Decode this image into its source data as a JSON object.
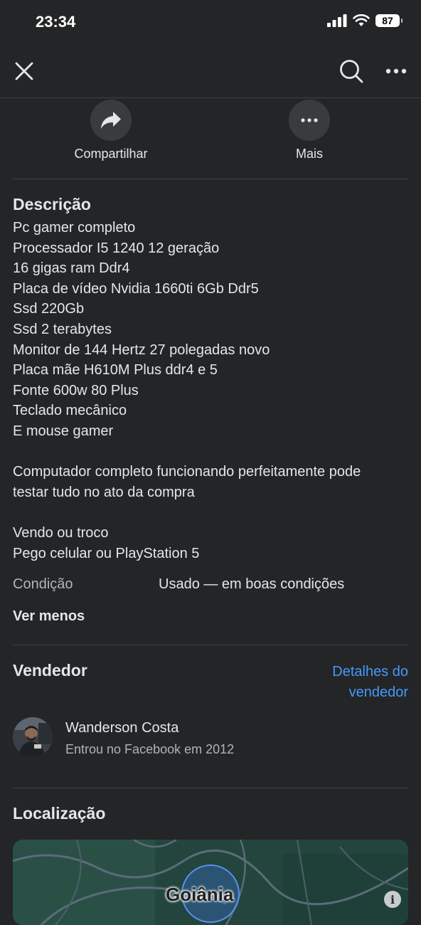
{
  "status_bar": {
    "time": "23:34",
    "battery": "87"
  },
  "actions": [
    {
      "label": "Compartilhar",
      "icon": "share-icon"
    },
    {
      "label": "Mais",
      "icon": "more-icon"
    }
  ],
  "description": {
    "title": "Descrição",
    "lines": [
      "Pc gamer completo",
      "Processador I5 1240  12 geração",
      "16 gigas ram Ddr4",
      "Placa de vídeo Nvidia 1660ti 6Gb Ddr5",
      "Ssd 220Gb",
      "Ssd 2 terabytes",
      "Monitor de 144 Hertz 27 polegadas novo",
      "Placa mãe H610M Plus ddr4 e 5",
      "Fonte 600w 80 Plus",
      "Teclado mecânico",
      "E mouse gamer",
      "",
      "Computador completo funcionando perfeitamente pode",
      "testar tudo no ato da compra",
      "",
      "Vendo ou troco",
      "Pego celular ou PlayStation 5"
    ],
    "condition_label": "Condição",
    "condition_value": "Usado — em boas condições",
    "see_less": "Ver menos"
  },
  "seller": {
    "title": "Vendedor",
    "details_link_line1": "Detalhes do",
    "details_link_line2": "vendedor",
    "name": "Wanderson Costa",
    "since": "Entrou no Facebook em 2012"
  },
  "location": {
    "title": "Localização",
    "city": "Goiânia"
  },
  "colors": {
    "background": "#242526",
    "link": "#4599ff",
    "text": "#e4e6eb",
    "muted": "#b0b3b8"
  }
}
